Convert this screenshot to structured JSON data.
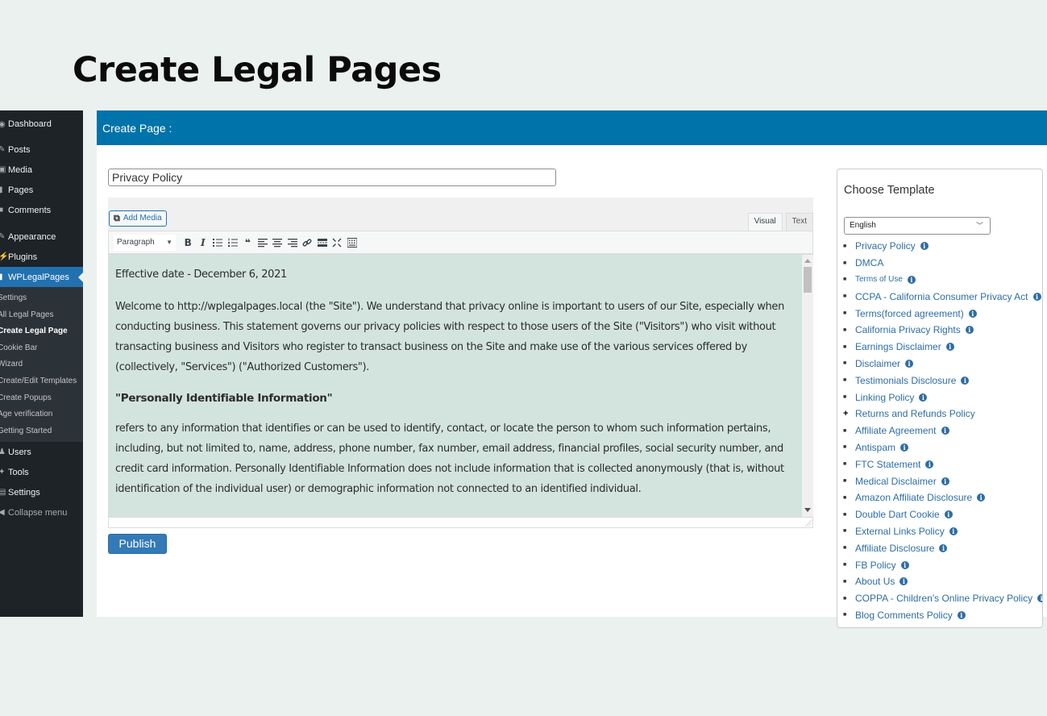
{
  "hero": {
    "title": "Create Legal Pages"
  },
  "sidebar": {
    "items_top": [
      {
        "label": "Dashboard",
        "icon": "dashboard-icon",
        "glyph": "◉"
      },
      {
        "label": "Posts",
        "icon": "pin-icon",
        "glyph": "✎"
      },
      {
        "label": "Media",
        "icon": "media-icon",
        "glyph": "▣"
      },
      {
        "label": "Pages",
        "icon": "pages-icon",
        "glyph": "▮"
      },
      {
        "label": "Comments",
        "icon": "comments-icon",
        "glyph": "■"
      },
      {
        "label": "Appearance",
        "icon": "brush-icon",
        "glyph": "✎"
      },
      {
        "label": "Plugins",
        "icon": "plugin-icon",
        "glyph": "⚡"
      },
      {
        "label": "WPLegalPages",
        "icon": "wplegalpages-icon",
        "glyph": "▮"
      }
    ],
    "submenu": [
      "Settings",
      "All Legal Pages",
      "Create Legal Page",
      "Cookie Bar",
      "Wizard",
      "Create/Edit Templates",
      "Create Popups",
      "Age verification",
      "Getting Started"
    ],
    "items_bottom": [
      {
        "label": "Users",
        "icon": "users-icon",
        "glyph": "♟"
      },
      {
        "label": "Tools",
        "icon": "tools-icon",
        "glyph": "✦"
      },
      {
        "label": "Settings",
        "icon": "settings-icon",
        "glyph": "▤"
      },
      {
        "label": "Collapse menu",
        "icon": "collapse-icon",
        "glyph": "◀"
      }
    ]
  },
  "panel": {
    "header": "Create Page :",
    "title_value": "Privacy Policy",
    "add_media": "Add Media",
    "tabs": {
      "visual": "Visual",
      "text": "Text"
    },
    "format_select": "Paragraph",
    "toolbar": [
      "bold",
      "italic",
      "bulleted-list",
      "numbered-list",
      "blockquote",
      "align-left",
      "align-center",
      "align-right",
      "link",
      "read-more",
      "fullscreen",
      "toolbar-toggle"
    ],
    "content": {
      "effective_date": "Effective date - December 6, 2021",
      "para1": "Welcome to http://wplegalpages.local (the \"Site\"). We understand that privacy online is important to users of our Site, especially when conducting business. This statement governs our privacy policies with respect to those users of the Site (\"Visitors\") who visit without transacting business and Visitors who register to transact business on the Site and make use of the various services offered by (collectively, \"Services\") (\"Authorized Customers\").",
      "heading": "\"Personally Identifiable Information\"",
      "para2": "refers to any information that identifies or can be used to identify, contact, or locate the person to whom such information pertains, including, but not limited to, name, address, phone number, fax number, email address, financial profiles, social security number, and credit card information. Personally Identifiable Information does not include information that is collected anonymously (that is, without identification of the individual user) or demographic information not connected to an identified individual."
    },
    "publish": "Publish"
  },
  "templates": {
    "title": "Choose Template",
    "language": "English",
    "items": [
      {
        "label": "Privacy Policy",
        "info": true
      },
      {
        "label": "DMCA",
        "info": false
      },
      {
        "label": "Terms of Use",
        "info": true,
        "small": true
      },
      {
        "label": "CCPA - California Consumer Privacy Act",
        "info": true
      },
      {
        "label": "Terms(forced agreement)",
        "info": true
      },
      {
        "label": "California Privacy Rights",
        "info": true
      },
      {
        "label": "Earnings Disclaimer",
        "info": true
      },
      {
        "label": "Disclaimer",
        "info": true
      },
      {
        "label": "Testimonials Disclosure",
        "info": true
      },
      {
        "label": "Linking Policy",
        "info": true
      },
      {
        "label": "Returns and Refunds Policy",
        "info": false,
        "plus": true
      },
      {
        "label": "Affiliate Agreement",
        "info": true
      },
      {
        "label": "Antispam",
        "info": true
      },
      {
        "label": "FTC Statement",
        "info": true
      },
      {
        "label": "Medical Disclaimer",
        "info": true
      },
      {
        "label": "Amazon Affiliate Disclosure",
        "info": true
      },
      {
        "label": "Double Dart Cookie",
        "info": true
      },
      {
        "label": "External Links Policy",
        "info": true
      },
      {
        "label": "Affiliate Disclosure",
        "info": true
      },
      {
        "label": "FB Policy",
        "info": true
      },
      {
        "label": "About Us",
        "info": true
      },
      {
        "label": "COPPA - Children's Online Privacy Policy",
        "info": true
      },
      {
        "label": "Blog Comments Policy",
        "info": true
      }
    ]
  },
  "colors": {
    "page_bg": "#ebf1ef",
    "sidebar_bg": "#1d2327",
    "accent": "#0073aa",
    "active_menu": "#2271b1",
    "editor_bg": "#d3e4de",
    "link": "#2e6da4",
    "publish": "#337ab7"
  }
}
